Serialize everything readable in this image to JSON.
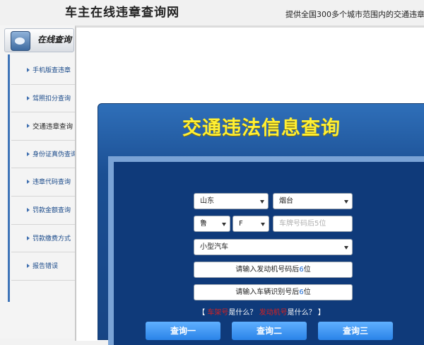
{
  "header": {
    "site_title": "车主在线违章查询网",
    "tagline": "提供全国300多个城市范围内的交通违章"
  },
  "sidebar": {
    "head_title": "在线查询",
    "items": [
      {
        "label": "手机版查违章"
      },
      {
        "label": "驾照扣分查询"
      },
      {
        "label": "交通违章查询"
      },
      {
        "label": "身份证真伪查询"
      },
      {
        "label": "违章代码查询"
      },
      {
        "label": "罚款金额查询"
      },
      {
        "label": "罚款缴费方式"
      },
      {
        "label": "报告错误"
      }
    ],
    "active_index": 2
  },
  "form": {
    "title": "交通违法信息查询",
    "province": "山东",
    "city": "烟台",
    "plate_prefix": "鲁",
    "plate_letter": "F",
    "plate_placeholder": "车牌号码后5位",
    "vehicle_type": "小型汽车",
    "engine_prefix": "请输入发动机号码后",
    "engine_num": "6",
    "engine_suffix": "位",
    "vin_prefix": "请输入车辆识别号后",
    "vin_num": "6",
    "vin_suffix": "位",
    "help_open": "【 ",
    "help_term1": "车架号",
    "help_q1": "是什么？ ",
    "help_term2": "发动机号",
    "help_q2": "是什么？ 】",
    "buttons": [
      "查询一",
      "查询二",
      "查询三"
    ]
  }
}
